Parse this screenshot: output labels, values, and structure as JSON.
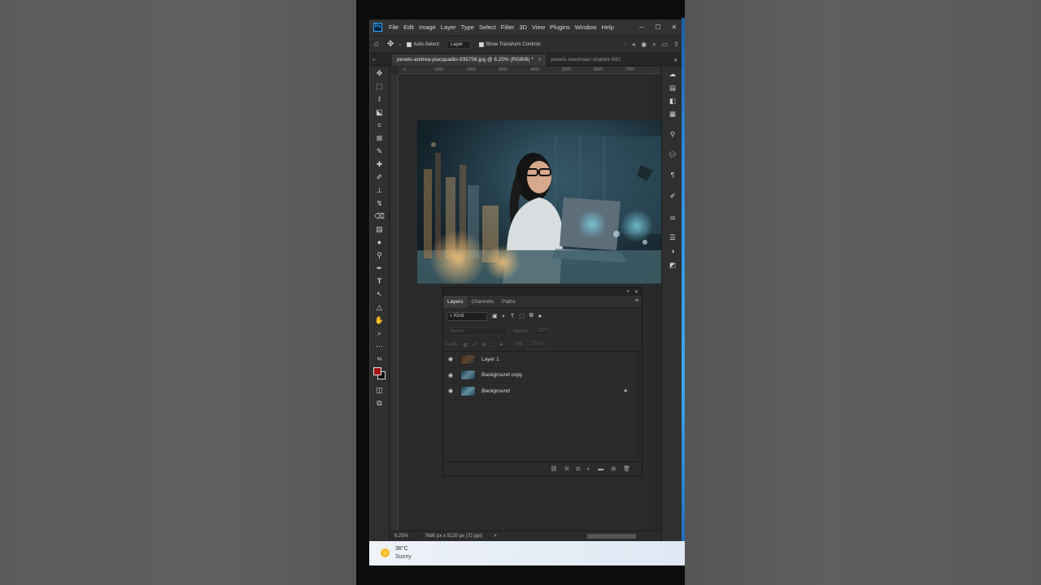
{
  "menu": {
    "app_icon": "Ps",
    "items": [
      "File",
      "Edit",
      "Image",
      "Layer",
      "Type",
      "Select",
      "Filter",
      "3D",
      "View",
      "Plugins",
      "Window",
      "Help"
    ],
    "window_controls": [
      "minimize-icon",
      "maximize-icon",
      "close-icon"
    ]
  },
  "options_bar": {
    "auto_select_label": "Auto-Select:",
    "auto_select_checked": true,
    "target_value": "Layer",
    "transform_label": "Show Transform Controls",
    "transform_checked": true
  },
  "tabs": [
    {
      "label": "pexels-andrea-piacquadio-935756.jpg @ 6.25% (RGB/8) *",
      "active": true,
      "close": "×"
    },
    {
      "label": "pexels-zeeshaan-shabbir-692",
      "active": false
    }
  ],
  "ruler": {
    "top_ticks": [
      "0",
      "1000",
      "2000",
      "3000",
      "4000",
      "5000",
      "6000",
      "7000"
    ]
  },
  "status": {
    "zoom": "6.25%",
    "doc_size": "7680 px x 5120 px (72 ppi)",
    "more": ">"
  },
  "layers_panel": {
    "tabs": [
      "Layers",
      "Channels",
      "Paths"
    ],
    "active_tab": "Layers",
    "kind_filter": "Kind",
    "blend_mode": "Normal",
    "opacity_label": "Opacity:",
    "opacity_value": "100%",
    "lock_label": "Lock:",
    "fill_label": "Fill:",
    "fill_value": "100%",
    "layers": [
      {
        "name": "Layer 1",
        "visible": true,
        "locked": false,
        "italic": false
      },
      {
        "name": "Background copy",
        "visible": true,
        "locked": false,
        "italic": false
      },
      {
        "name": "Background",
        "visible": true,
        "locked": true,
        "italic": true
      }
    ]
  },
  "colors": {
    "foreground": "#a31414",
    "background": "#000000",
    "accent": "#31a8ff"
  },
  "taskbar": {
    "temperature": "36°C",
    "condition": "Sunny"
  }
}
